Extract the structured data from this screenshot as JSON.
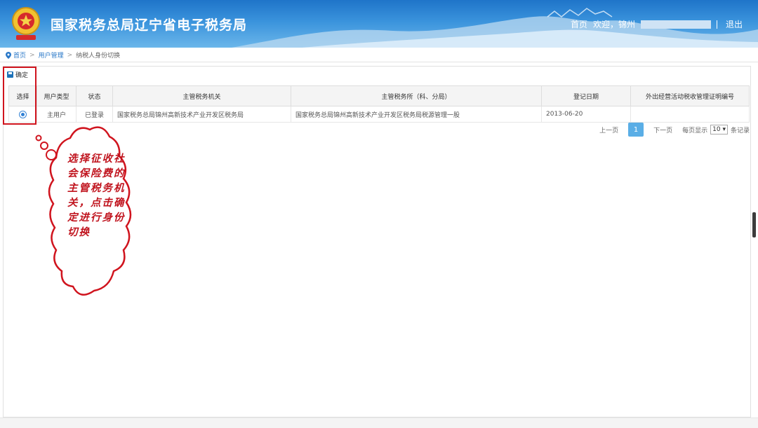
{
  "header": {
    "site_title": "国家税务总局辽宁省电子税务局",
    "nav": {
      "home": "首页",
      "welcome": "欢迎，锦州",
      "logout": "退出"
    }
  },
  "breadcrumb": {
    "home": "首页",
    "sep1": ">",
    "user_mgmt": "用户管理",
    "sep2": ">",
    "current": "纳税人身份切换"
  },
  "toolbar": {
    "confirm_label": "确定"
  },
  "table": {
    "headers": [
      "选择",
      "用户类型",
      "状态",
      "主管税务机关",
      "主管税务所（科、分局）",
      "登记日期",
      "外出经营活动税收管理证明编号"
    ],
    "rows": [
      {
        "user_type": "主用户",
        "status": "已登录",
        "tax_authority": "国家税务总局锦州高新技术产业开发区税务局",
        "tax_office": "国家税务总局锦州高新技术产业开发区税务局税源管理一股",
        "reg_date": "2013-06-20",
        "cert_no": ""
      }
    ]
  },
  "pager": {
    "prev": "上一页",
    "current_page": "1",
    "next": "下一页",
    "per_page_label": "每页显示",
    "per_page_value": "10 ▾",
    "records_label": "条记录"
  },
  "annotation": {
    "text": "选择征收社会保险费的主管税务机关，点击确定进行身份切换"
  },
  "colors": {
    "header_blue": "#2a80d2",
    "highlight_red": "#d0141e",
    "pager_active": "#5aaee6",
    "link_blue": "#2a78c8"
  }
}
